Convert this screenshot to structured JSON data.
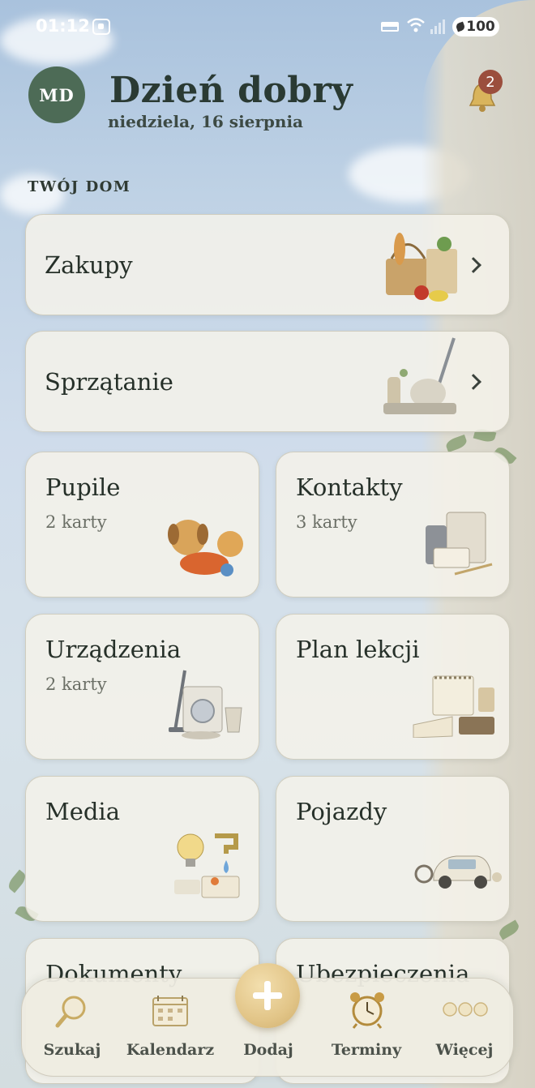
{
  "status_bar": {
    "time": "01:12",
    "battery": "100"
  },
  "header": {
    "avatar_initials": "MD",
    "greeting": "Dzień dobry",
    "date": "niedziela, 16 sierpnia",
    "notification_count": "2"
  },
  "section_label": "TWÓJ DOM",
  "cards": {
    "zakupy": {
      "title": "Zakupy",
      "icon": "groceries-illustration"
    },
    "sprzatanie": {
      "title": "Sprzątanie",
      "icon": "cleaning-illustration"
    },
    "pupile": {
      "title": "Pupile",
      "subtitle": "2 karty",
      "icon": "pets-illustration"
    },
    "kontakty": {
      "title": "Kontakty",
      "subtitle": "3 karty",
      "icon": "contacts-illustration"
    },
    "urzadzenia": {
      "title": "Urządzenia",
      "subtitle": "2 karty",
      "icon": "appliances-illustration"
    },
    "plan_lekcji": {
      "title": "Plan lekcji",
      "icon": "lesson-plan-illustration"
    },
    "media": {
      "title": "Media",
      "icon": "utilities-illustration"
    },
    "pojazdy": {
      "title": "Pojazdy",
      "icon": "vehicles-illustration"
    },
    "dokumenty": {
      "title": "Dokumenty"
    },
    "ubezpieczenia": {
      "title": "Ubezpieczenia"
    }
  },
  "bottom_nav": {
    "search": "Szukaj",
    "calendar": "Kalendarz",
    "add": "Dodaj",
    "appointments": "Terminy",
    "more": "Więcej"
  },
  "colors": {
    "avatar": "#4d6b56",
    "badge": "#9b4e3d",
    "accent_gold": "#e2c588"
  }
}
